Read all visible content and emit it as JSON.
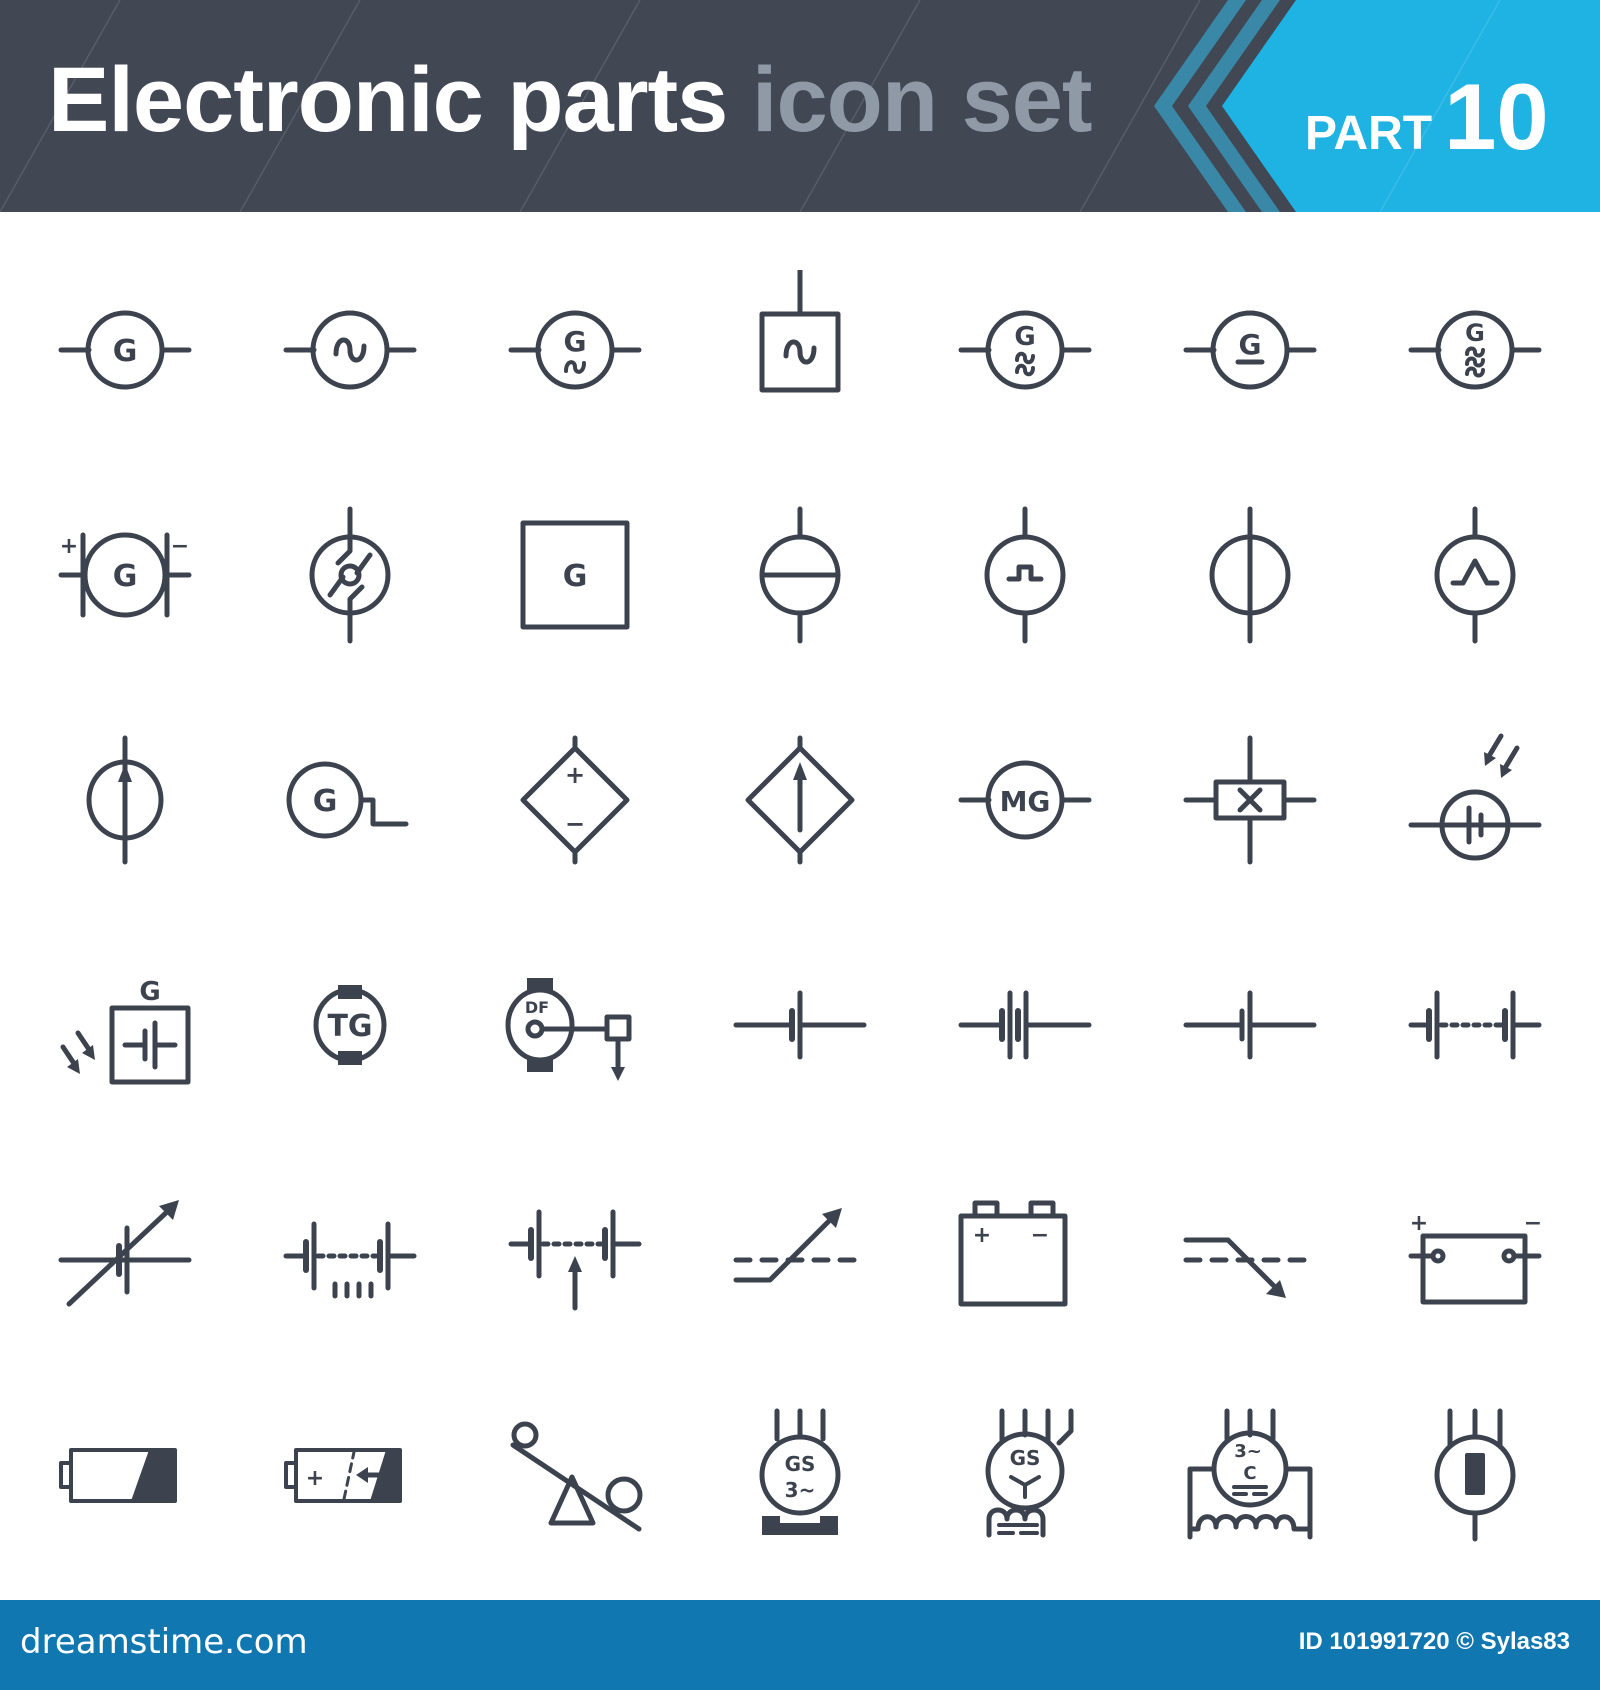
{
  "header": {
    "title_primary": "Electronic parts",
    "title_secondary": "icon set",
    "part_label": "PART",
    "part_number": "10",
    "colors": {
      "background": "#414753",
      "accent_blue": "#1fb3e3",
      "stripe_teal": "#3a88a8",
      "title_secondary": "#8f9aa6"
    }
  },
  "icon_color": "#3d434e",
  "icons": {
    "rows": [
      [
        {
          "name": "generator-icon",
          "label": "G"
        },
        {
          "name": "ac-generator-icon",
          "label": "~"
        },
        {
          "name": "ac-generator-g-icon",
          "label": "G",
          "sub": "~"
        },
        {
          "name": "ac-source-box-icon",
          "label": "~"
        },
        {
          "name": "two-phase-generator-icon",
          "label": "G",
          "sub": "≈"
        },
        {
          "name": "dc-generator-icon",
          "label": "G"
        },
        {
          "name": "three-phase-generator-icon",
          "label": "G",
          "sub": "≋"
        }
      ],
      [
        {
          "name": "dc-generator-brushes-icon",
          "label": "G",
          "plus": "+",
          "minus": "−"
        },
        {
          "name": "ideal-current-source-icon"
        },
        {
          "name": "generator-box-icon",
          "label": "G"
        },
        {
          "name": "voltage-source-icon"
        },
        {
          "name": "pulse-source-icon"
        },
        {
          "name": "current-source-icon"
        },
        {
          "name": "triangle-pulse-source-icon"
        }
      ],
      [
        {
          "name": "current-source-arrow-icon"
        },
        {
          "name": "generator-step-output-icon",
          "label": "G"
        },
        {
          "name": "controlled-voltage-source-icon",
          "plus": "+",
          "minus": "−"
        },
        {
          "name": "controlled-current-source-icon"
        },
        {
          "name": "motor-generator-icon",
          "label": "MG"
        },
        {
          "name": "crystal-oscillator-icon"
        },
        {
          "name": "photovoltaic-cell-icon"
        }
      ],
      [
        {
          "name": "solar-generator-icon",
          "label": "G"
        },
        {
          "name": "tachogenerator-icon",
          "label": "TG"
        },
        {
          "name": "dc-generator-field-icon",
          "label": "DF"
        },
        {
          "name": "single-cell-battery-icon"
        },
        {
          "name": "double-cell-battery-icon"
        },
        {
          "name": "cell-icon"
        },
        {
          "name": "multi-cell-battery-icon"
        }
      ],
      [
        {
          "name": "variable-cell-icon"
        },
        {
          "name": "tapped-battery-icon"
        },
        {
          "name": "adjustable-battery-icon"
        },
        {
          "name": "rising-switch-icon"
        },
        {
          "name": "car-battery-icon",
          "plus": "+",
          "minus": "−"
        },
        {
          "name": "falling-switch-icon"
        },
        {
          "name": "battery-terminals-icon",
          "plus": "+",
          "minus": "−"
        }
      ],
      [
        {
          "name": "low-battery-icon"
        },
        {
          "name": "charging-battery-icon",
          "plus": "+"
        },
        {
          "name": "seesaw-balance-icon"
        },
        {
          "name": "synchronous-generator-base-icon",
          "label": "GS",
          "sub": "3~"
        },
        {
          "name": "synchronous-generator-star-icon",
          "label": "GS"
        },
        {
          "name": "three-phase-compound-generator-icon",
          "label": "3~",
          "sub": "C"
        },
        {
          "name": "thermoelectric-generator-icon"
        }
      ]
    ]
  },
  "footer": {
    "brand": "dreamstime.com",
    "credit": "ID 101991720 © Sylas83",
    "background": "#1077b0"
  }
}
